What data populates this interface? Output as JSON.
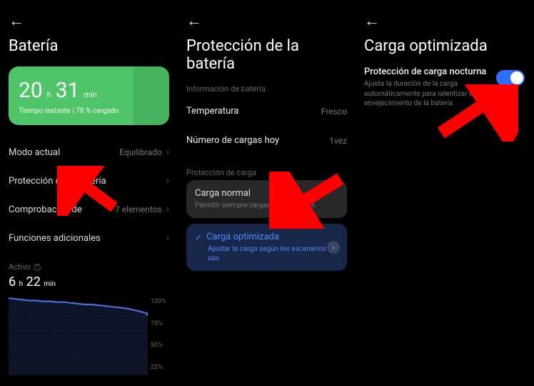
{
  "screen1": {
    "title": "Batería",
    "card": {
      "hours": "20",
      "hours_unit": "h",
      "mins": "31",
      "mins_unit": "min",
      "subtitle": "Tiempo restante | 78 % cargado"
    },
    "rows": {
      "mode_label": "Modo actual",
      "mode_value": "Equilibrado",
      "protection_label": "Protección de la batería",
      "check_label": "Comprobación de",
      "check_value": "7 elementos",
      "extras_label": "Funciones adicionales"
    },
    "active": {
      "label": "Activo",
      "hours": "6",
      "hours_unit": "h",
      "mins": "22",
      "mins_unit": "min"
    },
    "chart_y": {
      "p100": "100%",
      "p75": "75%",
      "p50": "50%",
      "p25": "25%"
    }
  },
  "screen2": {
    "title": "Protección de la batería",
    "info_section": "Información de batería",
    "temp_label": "Temperatura",
    "temp_value": "Fresco",
    "charges_label": "Número de cargas hoy",
    "charges_value": "1vez",
    "protect_section": "Protección de carga",
    "normal": {
      "title": "Carga normal",
      "sub": "Permitir siempre cargar hasta el 100%"
    },
    "optimized": {
      "title": "Carga optimizada",
      "sub": "Ajustar la carga según los escenarios de uso"
    }
  },
  "screen3": {
    "title": "Carga optimizada",
    "setting_title": "Protección de carga nocturna",
    "setting_desc": "Ajusta la duración de la carga automáticamente para ralentizar el envejecimiento de la batería"
  },
  "chart_data": {
    "type": "line",
    "title": "Activo",
    "xlabel": "",
    "ylabel": "%",
    "ylim": [
      0,
      100
    ],
    "x": [
      0,
      1,
      2,
      3,
      4,
      5,
      6,
      7,
      8,
      9,
      10,
      11,
      12,
      13,
      14,
      15,
      16,
      17,
      18,
      19,
      20,
      21,
      22,
      23
    ],
    "values": [
      98,
      97,
      96,
      95,
      95,
      94,
      94,
      93,
      93,
      92,
      91,
      90,
      90,
      89,
      88,
      87,
      86,
      85,
      84,
      83,
      82,
      81,
      80,
      78
    ]
  }
}
